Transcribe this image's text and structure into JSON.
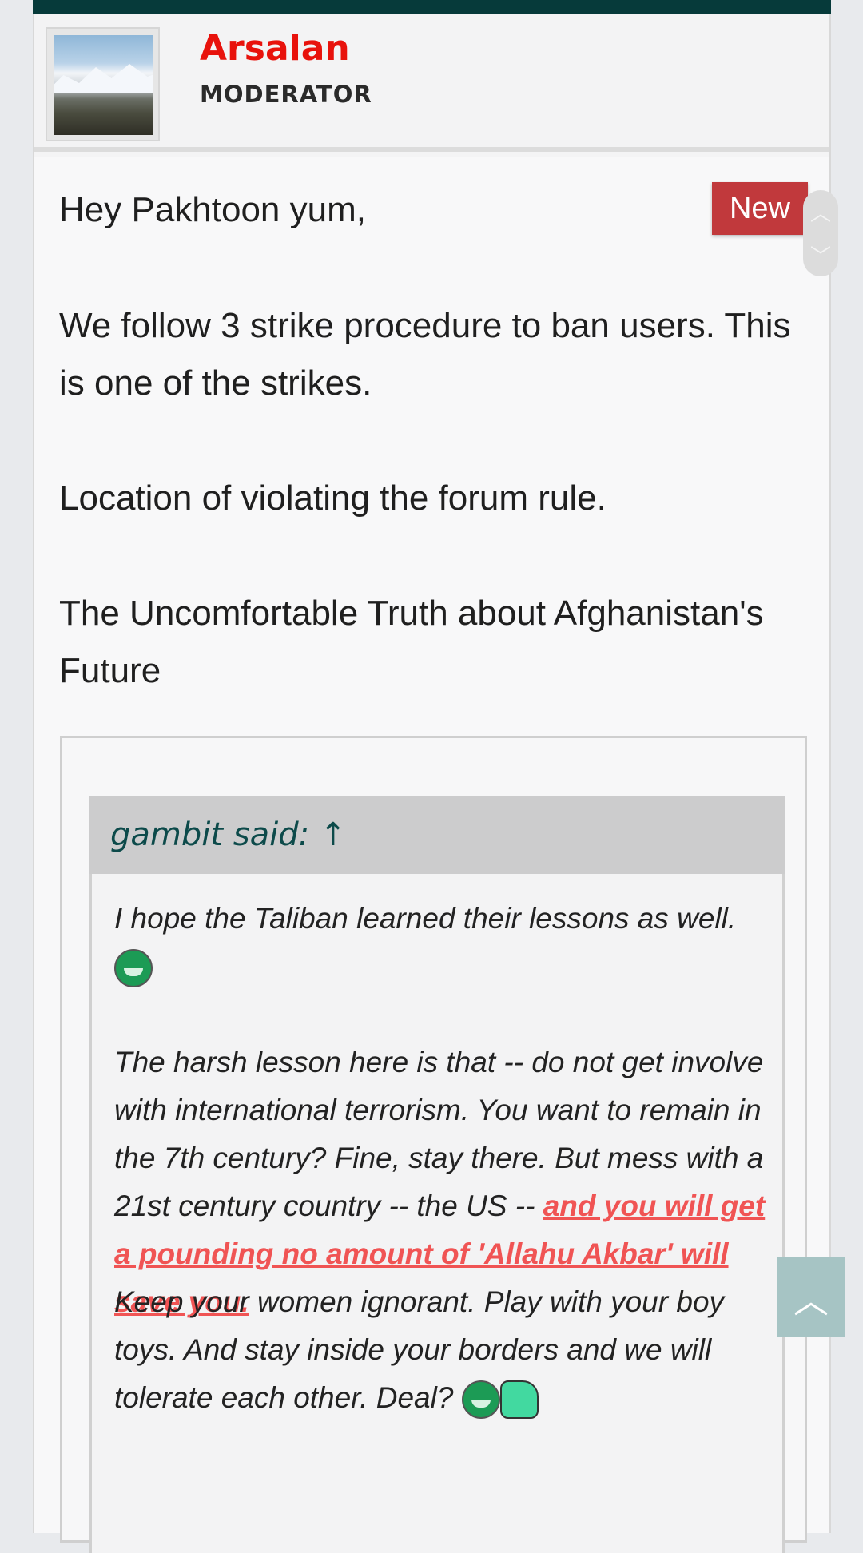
{
  "user": {
    "name": "Arsalan",
    "role": "MODERATOR",
    "avatar_icon": "mountain-avatar"
  },
  "post": {
    "badge": "New",
    "paragraphs": [
      "Hey Pakhtoon yum,",
      "We follow 3 strike procedure to ban users. This is one of the strikes.",
      "Location of violating the forum rule.",
      "The Uncomfortable Truth about Afghanistan's Future"
    ]
  },
  "quote": {
    "author": "gambit said: ↑",
    "p1": "I hope the Taliban learned their lessons as well.",
    "p2_normal": "The harsh lesson here is that -- do not get involve with international terrorism. You want to remain in the 7th century? Fine, stay there. But mess with a 21st century country -- the US --",
    "p2_highlight": "and you will get a pounding no amount of 'Allahu Akbar' will save you.",
    "p3": "Keep your women ignorant. Play with your boy toys. And stay inside your borders and we will tolerate each other. Deal?"
  },
  "icons": {
    "up": "chevron-up-icon",
    "down": "chevron-down-icon",
    "back_to_top": "arrow-up-icon",
    "smiley": "grin-smiley-icon",
    "thumb": "thumbs-up-icon"
  },
  "colors": {
    "topbar": "#063a3a",
    "username": "#e8120c",
    "badge": "#c1393c",
    "highlight": "#f05454",
    "quote_author": "#0c4a4a"
  }
}
